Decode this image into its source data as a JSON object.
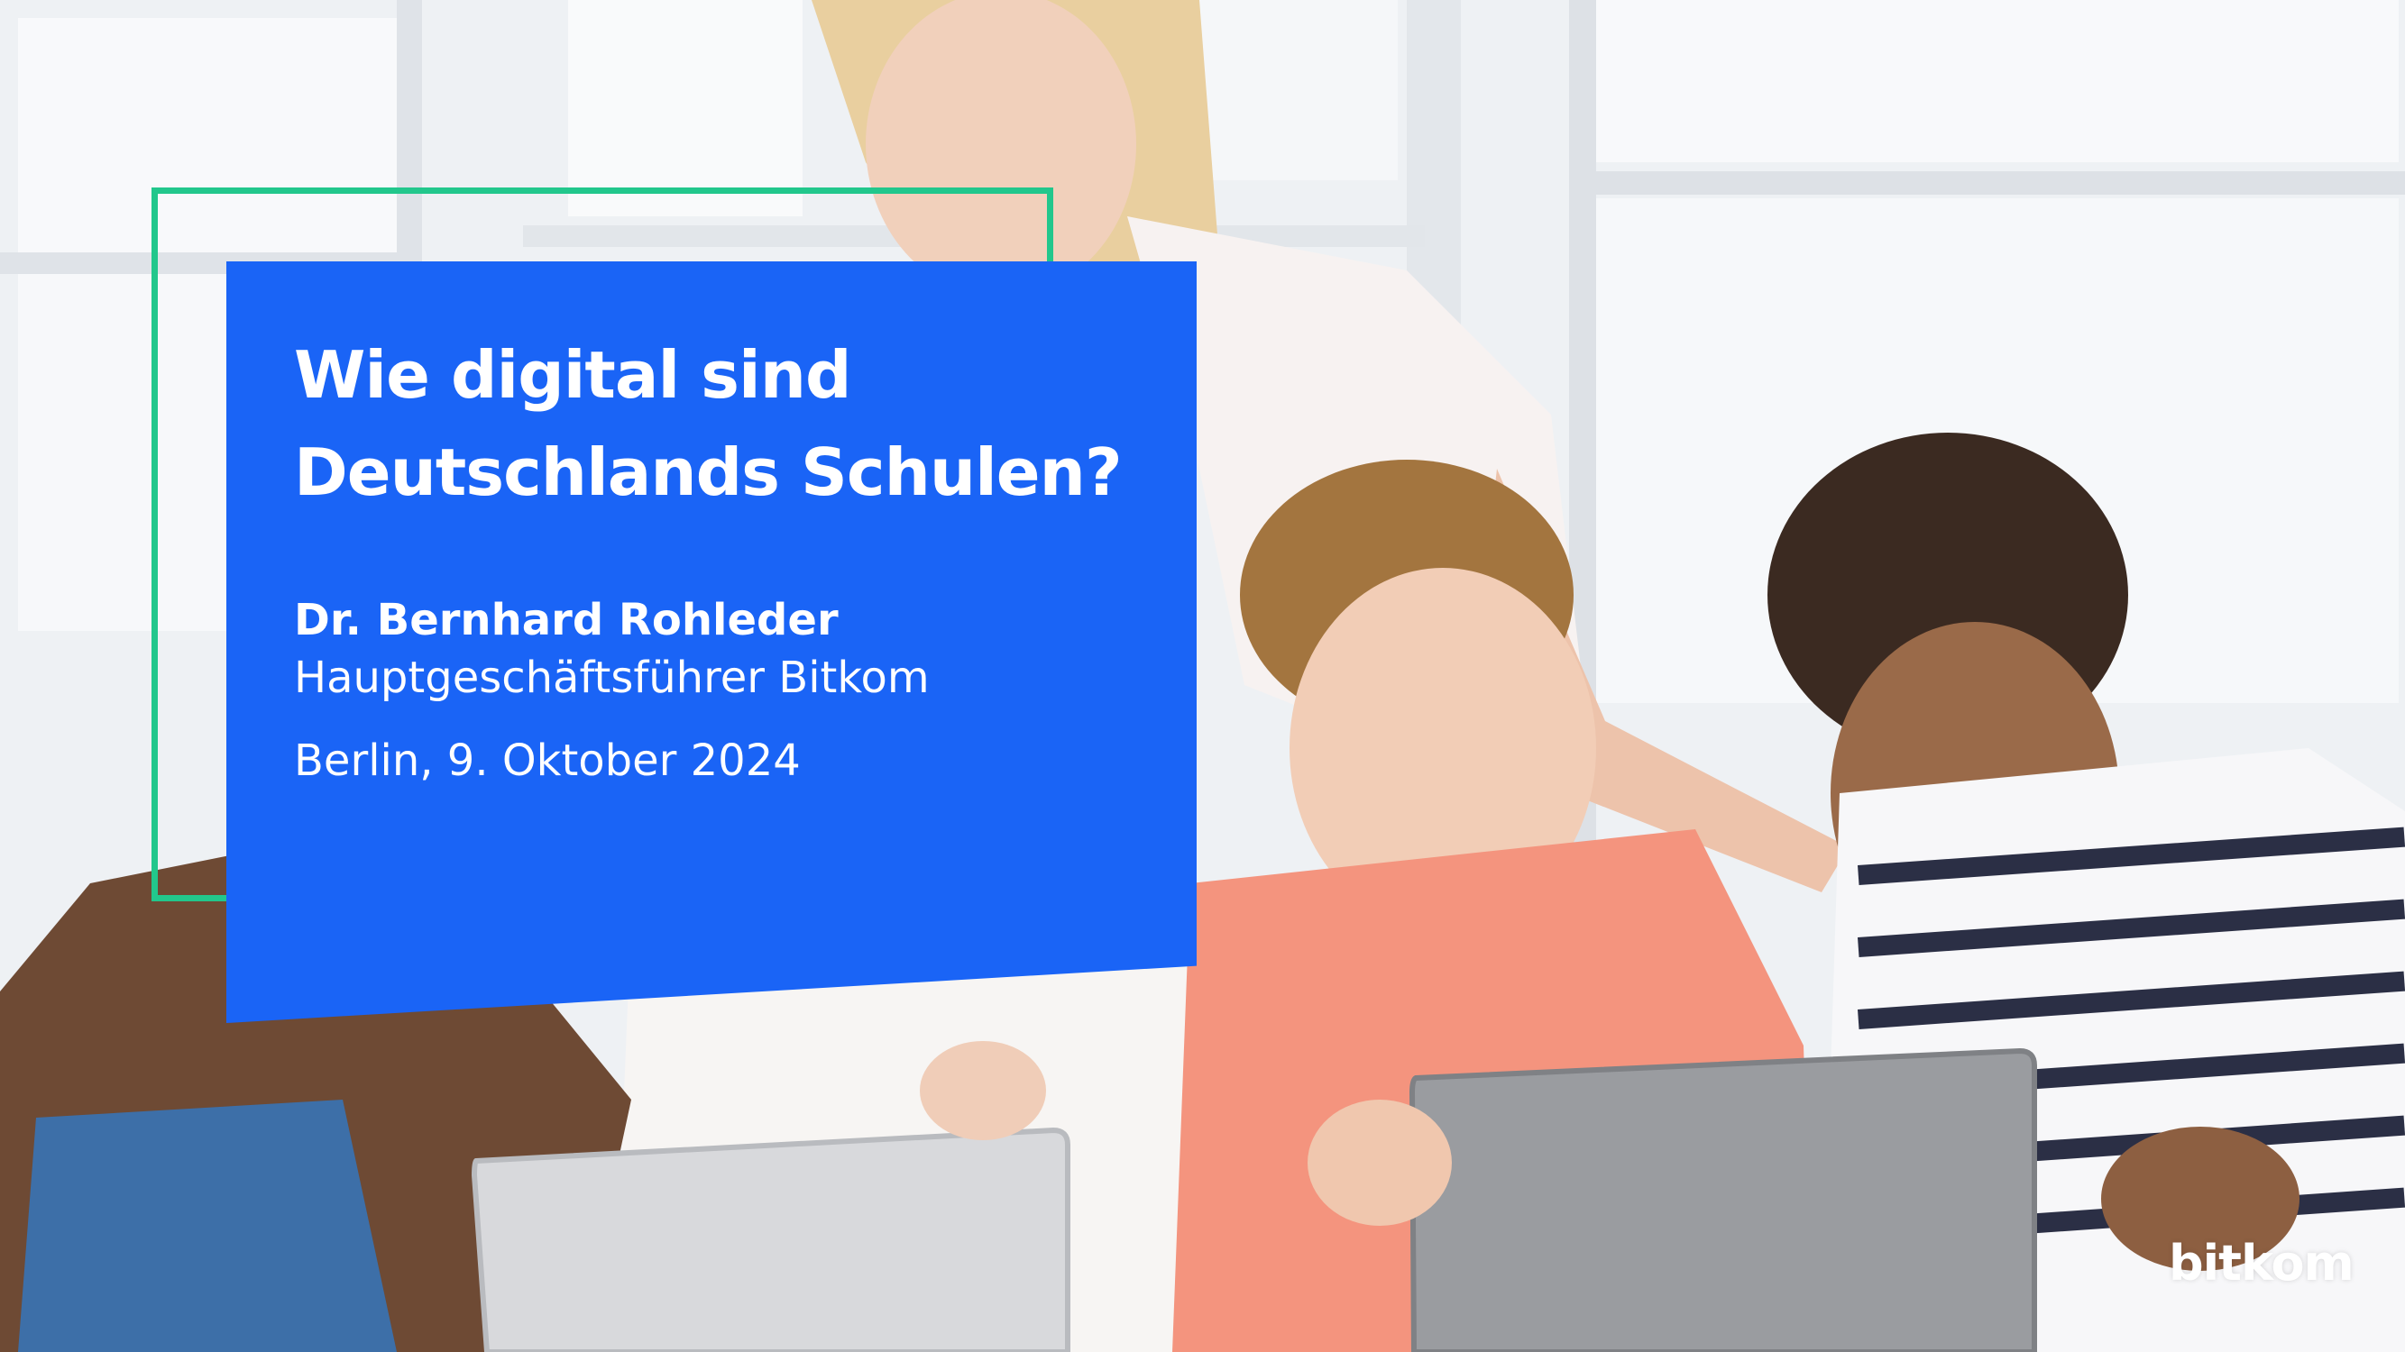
{
  "slide": {
    "title_line1": "Wie digital sind",
    "title_line2": "Deutschlands Schulen?",
    "speaker_name": "Dr. Bernhard Rohleder",
    "speaker_role": "Hauptgeschäftsführer Bitkom",
    "event_date": "Berlin, 9. Oktober 2024",
    "logo_text": "bitkom"
  },
  "colors": {
    "panel_blue": "#1a64f6",
    "frame_green": "#22c78c",
    "text_white": "#ffffff"
  }
}
